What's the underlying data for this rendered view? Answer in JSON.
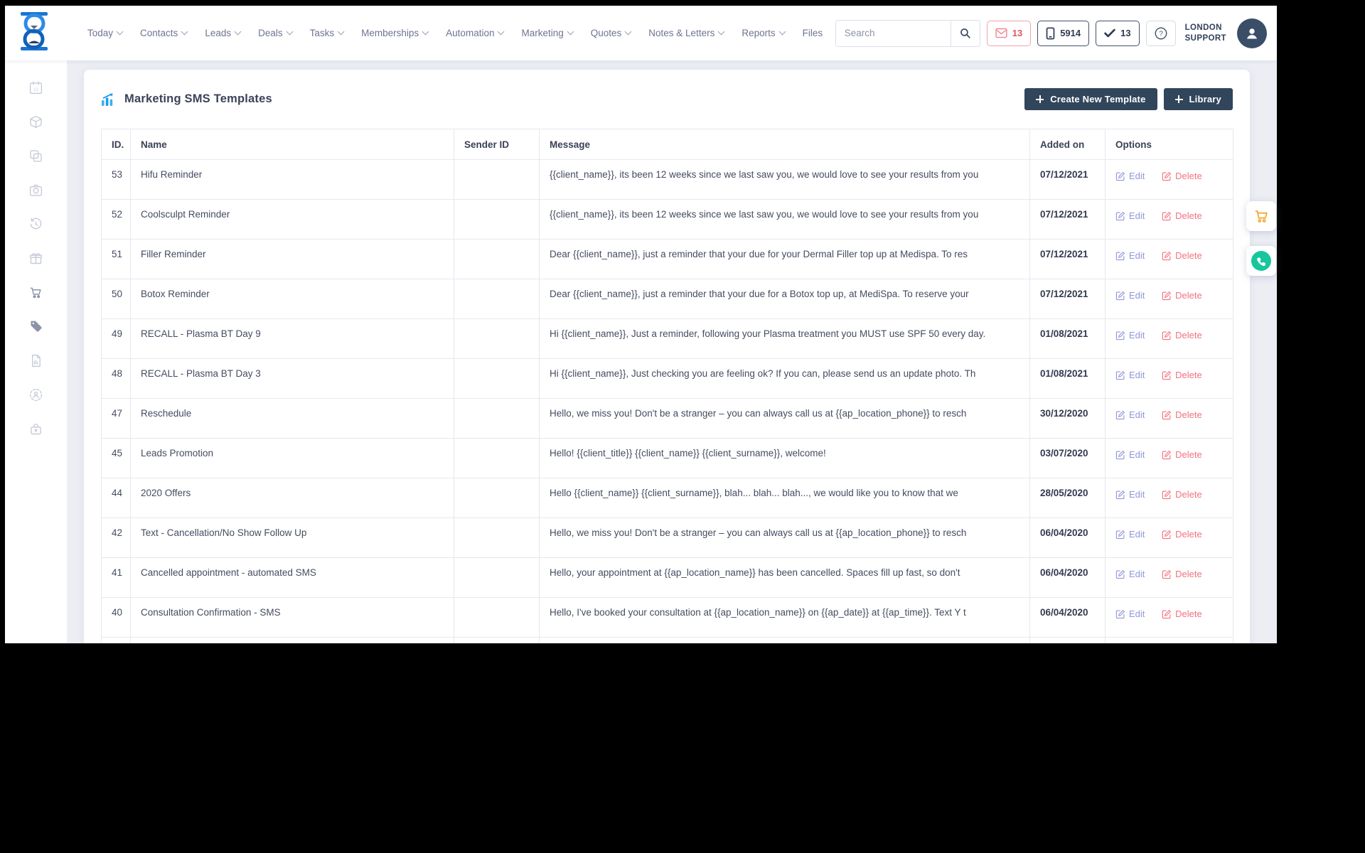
{
  "topnav": {
    "items": [
      {
        "label": "Today",
        "has_menu": true
      },
      {
        "label": "Contacts",
        "has_menu": true
      },
      {
        "label": "Leads",
        "has_menu": true
      },
      {
        "label": "Deals",
        "has_menu": true
      },
      {
        "label": "Tasks",
        "has_menu": true
      },
      {
        "label": "Memberships",
        "has_menu": true
      },
      {
        "label": "Automation",
        "has_menu": true
      },
      {
        "label": "Marketing",
        "has_menu": true
      },
      {
        "label": "Quotes",
        "has_menu": true
      },
      {
        "label": "Notes & Letters",
        "has_menu": true
      },
      {
        "label": "Reports",
        "has_menu": true
      },
      {
        "label": "Files",
        "has_menu": false
      }
    ],
    "search_placeholder": "Search",
    "badges": {
      "messages_count": "13",
      "phone_count": "5914",
      "tasks_count": "13"
    },
    "account": {
      "line1": "LONDON",
      "line2": "SUPPORT"
    }
  },
  "sidebar": {
    "icons": [
      {
        "name": "calendar-icon",
        "strong": false
      },
      {
        "name": "package-icon",
        "strong": false
      },
      {
        "name": "copy-icon",
        "strong": false
      },
      {
        "name": "camera-icon",
        "strong": false
      },
      {
        "name": "history-icon",
        "strong": false
      },
      {
        "name": "gift-icon",
        "strong": false
      },
      {
        "name": "cart-icon",
        "strong": true
      },
      {
        "name": "tags-icon",
        "strong": true
      },
      {
        "name": "report-icon",
        "strong": false
      },
      {
        "name": "user-sync-icon",
        "strong": false
      },
      {
        "name": "lockbox-icon",
        "strong": false
      }
    ]
  },
  "page": {
    "title": "Marketing SMS Templates",
    "create_button": "Create New Template",
    "library_button": "Library"
  },
  "table": {
    "columns": [
      "ID.",
      "Name",
      "Sender ID",
      "Message",
      "Added on",
      "Options"
    ],
    "edit_label": "Edit",
    "delete_label": "Delete",
    "rows": [
      {
        "id": "53",
        "name": "Hifu Reminder",
        "sender_id": "",
        "message": "{{client_name}}, its been 12 weeks since we last saw you, we would love to see your results from you",
        "added_on": "07/12/2021"
      },
      {
        "id": "52",
        "name": "Coolsculpt Reminder",
        "sender_id": "",
        "message": "{{client_name}}, its been 12 weeks since we last saw you, we would love to see your results from you",
        "added_on": "07/12/2021"
      },
      {
        "id": "51",
        "name": "Filler Reminder",
        "sender_id": "",
        "message": "Dear {{client_name}}, just a reminder that your due for your Dermal Filler top up at Medispa. To res",
        "added_on": "07/12/2021"
      },
      {
        "id": "50",
        "name": "Botox Reminder",
        "sender_id": "",
        "message": "Dear {{client_name}}, just a reminder that your due for a Botox top up, at MediSpa. To reserve your",
        "added_on": "07/12/2021"
      },
      {
        "id": "49",
        "name": "RECALL - Plasma BT Day 9",
        "sender_id": "",
        "message": "Hi {{client_name}}, Just a reminder, following your Plasma treatment you MUST use SPF 50 every day.",
        "added_on": "01/08/2021"
      },
      {
        "id": "48",
        "name": "RECALL - Plasma BT Day 3",
        "sender_id": "",
        "message": "Hi {{client_name}}, Just checking you are feeling ok? If you can, please send us an update photo. Th",
        "added_on": "01/08/2021"
      },
      {
        "id": "47",
        "name": "Reschedule",
        "sender_id": "",
        "message": "Hello, we miss you! Don't be a stranger – you can always call us at {{ap_location_phone}} to resch",
        "added_on": "30/12/2020"
      },
      {
        "id": "45",
        "name": "Leads Promotion",
        "sender_id": "",
        "message": "Hello! {{client_title}} {{client_name}} {{client_surname}}, welcome!",
        "added_on": "03/07/2020"
      },
      {
        "id": "44",
        "name": "2020 Offers",
        "sender_id": "",
        "message": "Hello {{client_name}} {{client_surname}}, blah... blah... blah..., we would like you to know that we",
        "added_on": "28/05/2020"
      },
      {
        "id": "42",
        "name": "Text - Cancellation/No Show Follow Up",
        "sender_id": "",
        "message": "Hello, we miss you! Don't be a stranger – you can always call us at {{ap_location_phone}} to resch",
        "added_on": "06/04/2020"
      },
      {
        "id": "41",
        "name": "Cancelled appointment - automated SMS",
        "sender_id": "",
        "message": "Hello, your appointment at {{ap_location_name}} has been cancelled. Spaces fill up fast, so don't",
        "added_on": "06/04/2020"
      },
      {
        "id": "40",
        "name": "Consultation Confirmation - SMS",
        "sender_id": "",
        "message": "Hello, I've booked your consultation at {{ap_location_name}} on {{ap_date}} at {{ap_time}}. Text Y t",
        "added_on": "06/04/2020"
      }
    ]
  },
  "colors": {
    "page_background": "#eceef4",
    "button_dark": "#31455b",
    "edit_link": "#9197d8",
    "delete_link": "#f2727e",
    "mail_badge": "#e4525f",
    "logo_blue": "#1b75d0",
    "title_icon_blue": "#2aa4f0",
    "cart_float": "#f2a93b",
    "phone_float": "#16c79e"
  }
}
